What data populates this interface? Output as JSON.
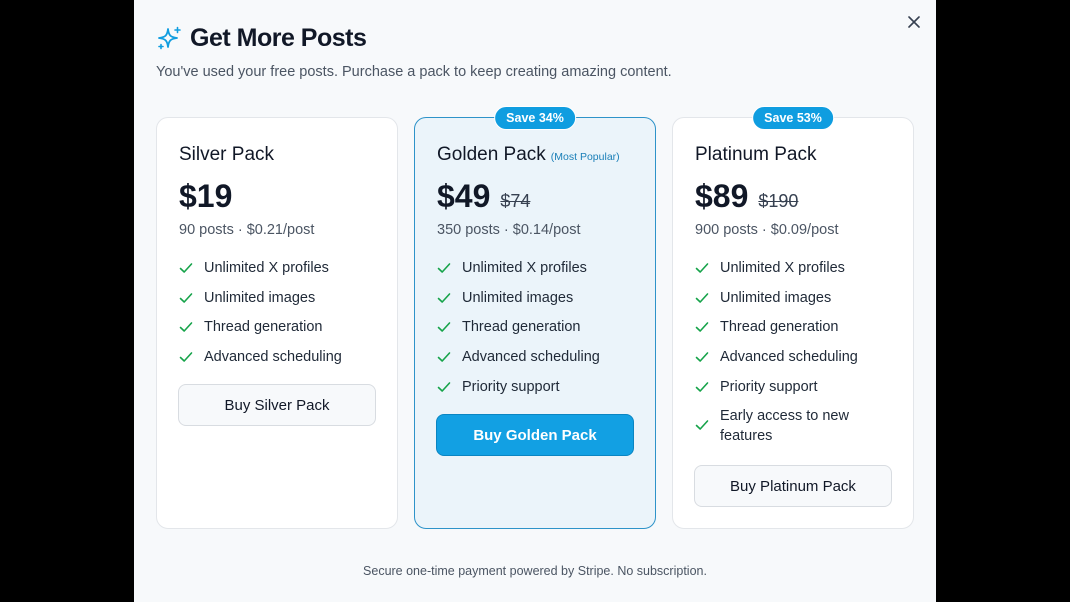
{
  "modal": {
    "title": "Get More Posts",
    "subtitle": "You've used your free posts. Purchase a pack to keep creating amazing content.",
    "footer": "Secure one-time payment powered by Stripe. No subscription.",
    "accent_color": "#0f9de0",
    "check_color": "#16a34a",
    "icons": {
      "header": "sparkles-icon",
      "close": "close-icon",
      "feature": "check-icon"
    }
  },
  "packs": [
    {
      "name": "Silver Pack",
      "price": "$19",
      "posts": "90 posts · $0.21/post",
      "features": [
        "Unlimited X profiles",
        "Unlimited images",
        "Thread generation",
        "Advanced scheduling"
      ],
      "button": "Buy Silver Pack"
    },
    {
      "name": "Golden Pack",
      "tag": "(Most Popular)",
      "badge": "Save 34%",
      "price": "$49",
      "old_price": "$74",
      "posts": "350 posts · $0.14/post",
      "features": [
        "Unlimited X profiles",
        "Unlimited images",
        "Thread generation",
        "Advanced scheduling",
        "Priority support"
      ],
      "button": "Buy Golden Pack"
    },
    {
      "name": "Platinum Pack",
      "badge": "Save 53%",
      "price": "$89",
      "old_price": "$190",
      "posts": "900 posts · $0.09/post",
      "features": [
        "Unlimited X profiles",
        "Unlimited images",
        "Thread generation",
        "Advanced scheduling",
        "Priority support",
        "Early access to new features"
      ],
      "button": "Buy Platinum Pack"
    }
  ]
}
